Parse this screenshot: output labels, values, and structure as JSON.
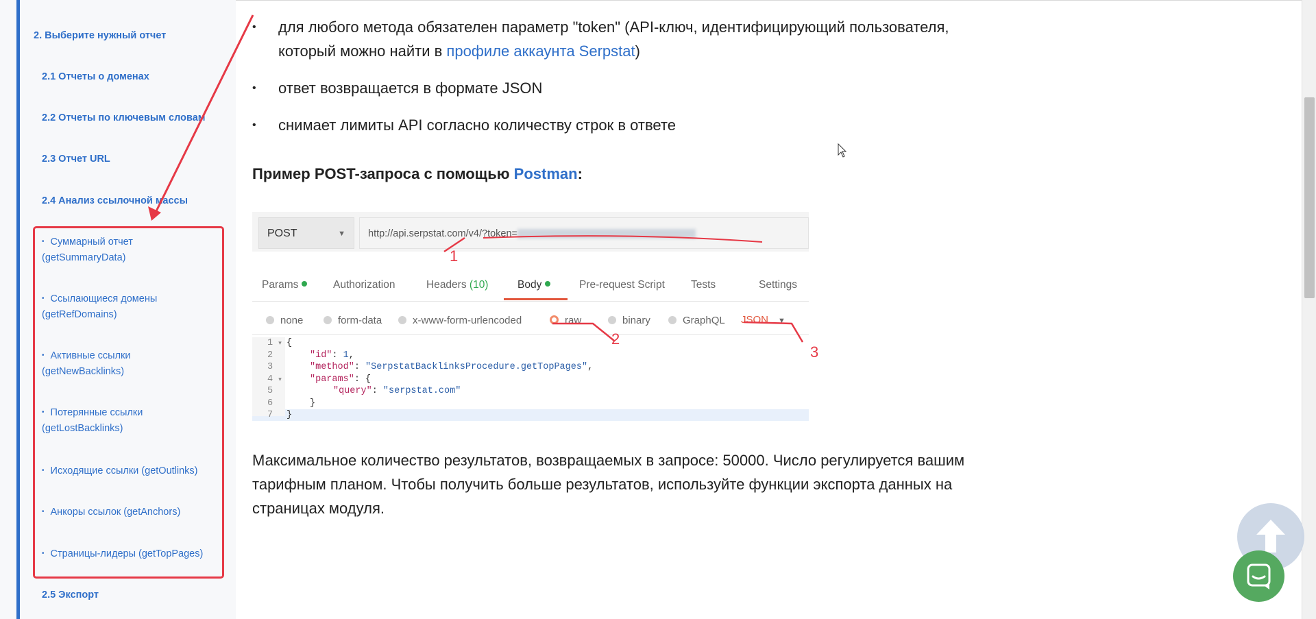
{
  "sidebar": {
    "heading": "2. Выберите нужный отчет",
    "items": [
      "2.1 Отчеты о доменах",
      "2.2 Отчеты по ключевым словам",
      "2.3 Отчет URL",
      "2.4 Анализ ссылочной массы"
    ],
    "subitems": [
      {
        "line1": "Суммарный отчет",
        "line2": "(getSummaryData)"
      },
      {
        "line1": "Ссылающиеся домены",
        "line2": "(getRefDomains)"
      },
      {
        "line1": "Активные ссылки",
        "line2": "(getNewBacklinks)"
      },
      {
        "line1": "Потерянные ссылки",
        "line2": "(getLostBacklinks)"
      },
      {
        "line1": "Исходящие ссылки (getOutlinks)",
        "line2": ""
      },
      {
        "line1": "Анкоры ссылок (getAnchors)",
        "line2": ""
      },
      {
        "line1": "Страницы-лидеры (getTopPages)",
        "line2": ""
      }
    ],
    "bullet_char": "•",
    "last_item": "2.5 Экспорт"
  },
  "main": {
    "bullets": [
      {
        "text_before": "для любого метода обязателен параметр \"token\" (API-ключ, идентифицирующий пользователя, который можно найти в ",
        "link": "профиле аккаунта Serpstat",
        "text_after": ")"
      },
      {
        "text_before": "ответ возвращается в формате JSON",
        "link": "",
        "text_after": ""
      },
      {
        "text_before": "снимает лимиты API согласно количеству строк в ответе",
        "link": "",
        "text_after": ""
      }
    ],
    "bullet_char": "•",
    "post_example": {
      "text": "Пример POST-запроса с помощью ",
      "link": "Postman",
      "suffix": ":"
    },
    "paragraph": "Максимальное количество результатов, возвращаемых в запросе: 50000. Число регулируется вашим тарифным планом. Чтобы получить больше результатов, используйте функции экспорта данных на страницах модуля."
  },
  "postman": {
    "method": "POST",
    "url": "http://api.serpstat.com/v4/?token=",
    "tabs": {
      "params": "Params",
      "authorization": "Authorization",
      "headers": "Headers",
      "headers_count": "(10)",
      "body": "Body",
      "prerequest": "Pre-request Script",
      "tests": "Tests",
      "settings": "Settings"
    },
    "body_types": {
      "none": "none",
      "form_data": "form-data",
      "urlencoded": "x-www-form-urlencoded",
      "raw": "raw",
      "binary": "binary",
      "graphql": "GraphQL",
      "format": "JSON"
    },
    "code_lines": [
      {
        "n": "1",
        "arrow": "▾"
      },
      {
        "n": "2",
        "arrow": ""
      },
      {
        "n": "3",
        "arrow": ""
      },
      {
        "n": "4",
        "arrow": "▾"
      },
      {
        "n": "5",
        "arrow": ""
      },
      {
        "n": "6",
        "arrow": ""
      },
      {
        "n": "7",
        "arrow": ""
      }
    ],
    "code": {
      "open": "{",
      "id_key": "\"id\"",
      "id_val": "1",
      "method_key": "\"method\"",
      "method_val": "\"SerpstatBacklinksProcedure.getTopPages\"",
      "params_key": "\"params\"",
      "query_key": "\"query\"",
      "query_val": "\"serpstat.com\"",
      "inner_close": "}",
      "close": "}"
    },
    "annotations": [
      "1",
      "2",
      "3"
    ]
  },
  "colors": {
    "accent": "#2f6fc9",
    "annotation": "#e63946",
    "postman_orange": "#e2573d",
    "chat_green": "#55a960"
  },
  "icons": {
    "scroll_top": "arrow-up-icon",
    "chat": "chat-icon",
    "cursor": "mouse-cursor-icon"
  }
}
